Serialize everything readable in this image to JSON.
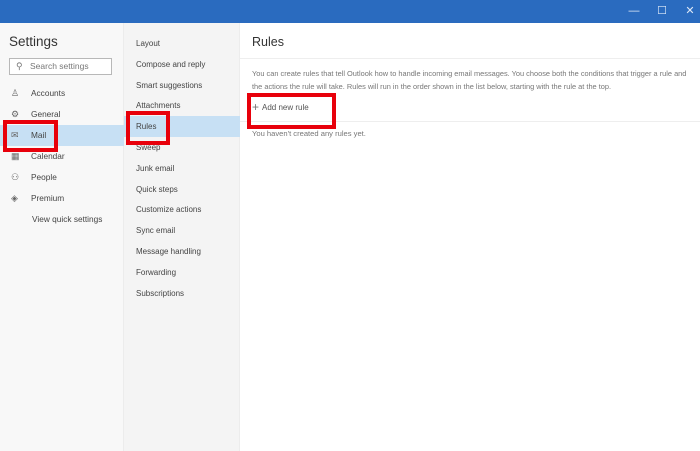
{
  "window": {
    "controls": [
      {
        "name": "minimize-icon",
        "glyph": "—"
      },
      {
        "name": "maximize-icon",
        "glyph": "☐"
      },
      {
        "name": "close-icon",
        "glyph": "✕"
      }
    ]
  },
  "settings": {
    "title": "Settings",
    "search_placeholder": "Search settings",
    "items": [
      {
        "label": "Accounts",
        "icon": "person-icon",
        "glyph": "♙"
      },
      {
        "label": "General",
        "icon": "gear-icon",
        "glyph": "⚙"
      },
      {
        "label": "Mail",
        "icon": "mail-icon",
        "glyph": "✉",
        "selected": true
      },
      {
        "label": "Calendar",
        "icon": "calendar-icon",
        "glyph": "▦"
      },
      {
        "label": "People",
        "icon": "people-icon",
        "glyph": "⚇"
      },
      {
        "label": "Premium",
        "icon": "diamond-icon",
        "glyph": "◈"
      }
    ],
    "view_quick": "View quick settings"
  },
  "mail_nav": {
    "items": [
      "Layout",
      "Compose and reply",
      "Smart suggestions",
      "Attachments",
      "Rules",
      "Sweep",
      "Junk email",
      "Quick steps",
      "Customize actions",
      "Sync email",
      "Message handling",
      "Forwarding",
      "Subscriptions"
    ],
    "selected": "Rules"
  },
  "rules": {
    "title": "Rules",
    "description": "You can create rules that tell Outlook how to handle incoming email messages. You choose both the conditions that trigger a rule and the actions the rule will take. Rules will run in the order shown in the list below, starting with the rule at the top.",
    "add_label": "Add new rule",
    "empty_text": "You haven't created any rules yet."
  },
  "colors": {
    "titlebar": "#2a6bbf",
    "selection": "#c7e0f4",
    "highlight": "#e8000b"
  }
}
